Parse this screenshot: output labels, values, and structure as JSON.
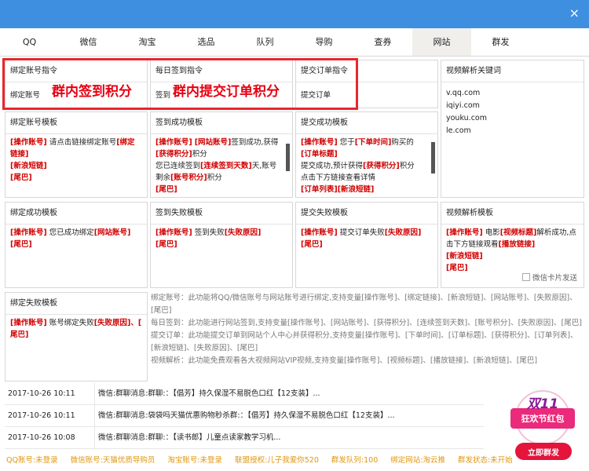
{
  "window": {
    "close": "×"
  },
  "tabs": [
    "QQ",
    "微信",
    "淘宝",
    "选品",
    "队列",
    "导购",
    "查券",
    "网站",
    "群发"
  ],
  "cmd": {
    "bind": {
      "title": "绑定账号指令",
      "value": "绑定账号"
    },
    "sign": {
      "title": "每日签到指令",
      "value": "签到"
    },
    "order": {
      "title": "提交订单指令",
      "value": "提交订单"
    }
  },
  "overlay": {
    "sign_points": "群内签到积分",
    "order_points": "群内提交订单积分"
  },
  "video": {
    "title": "视频解析关键词",
    "keywords": [
      "v.qq.com",
      "iqiyi.com",
      "youku.com",
      "le.com"
    ]
  },
  "tpl_bind": {
    "title": "绑定账号模板",
    "l1a": "[操作账号]",
    "l1b": " 请点击链接绑定账号",
    "l1c": "[绑定链接]",
    "l2": "[新浪短链]",
    "l3": "[尾巴]"
  },
  "tpl_signok": {
    "title": "签到成功模板",
    "a": "[操作账号]",
    "b": "[网站账号]",
    "c": "签到成功,获得",
    "d": "[获得积分]",
    "e": "积分",
    "f": "您已连续签到",
    "g": "[连续签到天数]",
    "h": "天,账号剩余",
    "i": "[账号积分]",
    "j": "积分",
    "k": "[尾巴]"
  },
  "tpl_orderok": {
    "title": "提交成功模板",
    "a": "[操作账号]",
    "b": " 您于",
    "c": "[下单时间]",
    "d": "购买的",
    "e": "[订单标题]",
    "f": "提交成功,预计获得",
    "g": "[获得积分]",
    "h": "积分",
    "i": "点击下方链接查看详情",
    "j": "[订单列表]",
    "k": "[新浪短链]"
  },
  "tpl_bindok": {
    "title": "绑定成功模板",
    "a": "[操作账号]",
    "b": " 您已成功绑定",
    "c": "[网站账号]",
    "d": "[尾巴]"
  },
  "tpl_signfail": {
    "title": "签到失败模板",
    "a": "[操作账号]",
    "b": " 签到失败",
    "c": "[失败原因]",
    "d": "[尾巴]"
  },
  "tpl_orderfail": {
    "title": "提交失败模板",
    "a": "[操作账号]",
    "b": " 提交订单失败",
    "c": "[失败原因]",
    "d": "[尾巴]"
  },
  "tpl_video": {
    "title": "视频解析模板",
    "a": "[操作账号]",
    "b": " 电影",
    "c": "[视频标题]",
    "d": "解析成功,点击下方链接观看",
    "e": "[播放链接]",
    "f": "[新浪短链]",
    "g": "[尾巴]",
    "chk": "微信卡片发送"
  },
  "tpl_bindfail": {
    "title": "绑定失败模板",
    "a": "[操作账号]",
    "b": " 账号绑定失败",
    "c": "[失败原因]",
    "d": "、[",
    "e": "尾巴]"
  },
  "descs": [
    "绑定账号：此功能将QQ/微信账号与网站账号进行绑定,支持变量[操作账号]、[绑定链接]、[新浪短链]、[网站账号]、[失败原因]、[尾巴]",
    "每日签到：此功能进行网站签到,支持变量[操作账号]、[网站账号]、[获得积分]、[连续签到天数]、[账号积分]、[失败原因]、[尾巴]",
    "提交订单：此功能提交订单到网站个人中心并获得积分,支持变量[操作账号]、[下单时间]、[订单标题]、[获得积分]、[订单列表]、[新浪短链]、[失败原因]、[尾巴]",
    "视频解析：此功能免费观看各大视频网站VIP视频,支持变量[操作账号]、[视频标题]、[播放链接]、[新浪短链]、[尾巴]"
  ],
  "logs": [
    {
      "time": "2017-10-26 10:11",
      "msg": "微信:群聊消息:群聊:：【倡芳】持久保湿不易脱色口红【12支装】..."
    },
    {
      "time": "2017-10-26 10:11",
      "msg": "微信:群聊消息:袋袋吗天猫优惠购物秒杀群:：【倡芳】持久保湿不易脱色口红【12支装】..."
    },
    {
      "time": "2017-10-26 10:08",
      "msg": "微信:群聊消息:群聊:：【读书郎】儿童点读家教学习机..."
    }
  ],
  "promo": {
    "line1": "双11",
    "line2": "狂欢节红包",
    "button": "立即群发"
  },
  "status": [
    "QQ账号:未登录",
    "微信账号:天猫优质导购员",
    "淘宝账号:未登录",
    "联盟授权:儿子我爱你520",
    "群发队列:100",
    "绑定网站:淘云推",
    "群发状态:未开始"
  ],
  "colors": {
    "titlebar": "#3f8fe0",
    "accent_red": "#d10000",
    "status": "#e0960f"
  }
}
